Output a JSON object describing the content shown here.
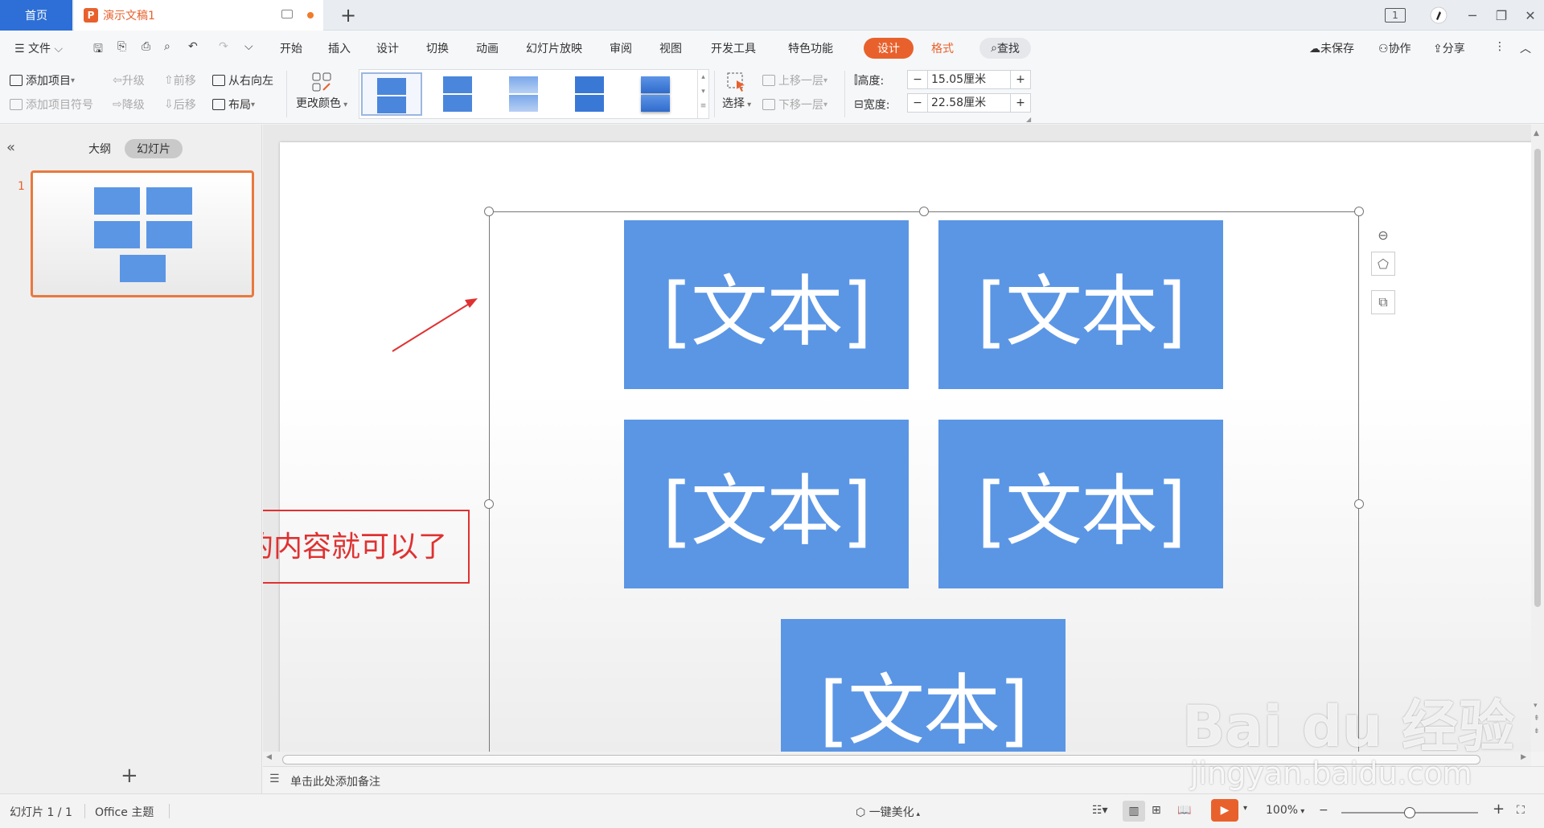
{
  "titlebar": {
    "home_tab": "首页",
    "doc_tab": "演示文稿1",
    "doc_tab_icon": "P",
    "new_tab": "+",
    "page_indicator": "1"
  },
  "menu": {
    "file": "文件",
    "tabs": [
      "开始",
      "插入",
      "设计",
      "切换",
      "动画",
      "幻灯片放映",
      "审阅",
      "视图",
      "开发工具",
      "特色功能"
    ],
    "design_active": "设计",
    "format": "格式",
    "search": "查找",
    "unsaved": "未保存",
    "collab": "协作",
    "share": "分享"
  },
  "ribbon": {
    "add_item": "添加项目",
    "add_bullet": "添加项目符号",
    "promote": "升级",
    "demote": "降级",
    "move_forward": "前移",
    "move_back": "后移",
    "right_to_left": "从右向左",
    "layout": "布局",
    "change_color": "更改颜色",
    "select": "选择",
    "bring_forward": "上移一层",
    "send_backward": "下移一层",
    "height_label": "高度:",
    "height_value": "15.05厘米",
    "width_label": "宽度:",
    "width_value": "22.58厘米",
    "minus": "−",
    "plus": "+"
  },
  "left_pane": {
    "outline_tab": "大纲",
    "slides_tab": "幻灯片",
    "slide_number": "1",
    "add_slide": "+"
  },
  "slide": {
    "placeholders": [
      "[文本]",
      "[文本]",
      "[文本]",
      "[文本]",
      "[文本]"
    ],
    "annotation": "编辑需要的内容就可以了"
  },
  "notes": {
    "placeholder": "单击此处添加备注"
  },
  "status": {
    "slide_count": "幻灯片 1 / 1",
    "theme": "Office 主题",
    "beautify": "一键美化",
    "zoom": "100%"
  },
  "watermark": {
    "main": "Bai du 经验",
    "sub": "jingyan.baidu.com"
  },
  "colors": {
    "accent": "#e8612c",
    "home_tab": "#2d6fd6",
    "smartart_fill": "#5b96e5",
    "annotation": "#e03131"
  }
}
